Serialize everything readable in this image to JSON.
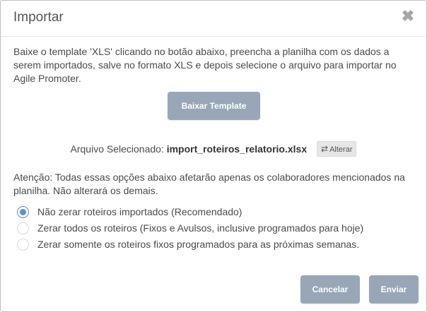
{
  "dialog": {
    "title": "Importar",
    "close_icon": "close-icon"
  },
  "description": "Baixe o template 'XLS' clicando no botão abaixo, preencha a planilha com os dados a serem importados, salve no formato XLS e depois selecione o arquivo para importar no Agile Promoter.",
  "download_button": "Baixar Template",
  "file": {
    "label": "Arquivo Selecionado:",
    "name": "import_roteiros_relatorio.xlsx",
    "change_icon": "swap-icon",
    "change_label": "Alterar"
  },
  "warning": "Atenção: Todas essas opções abaixo afetarão apenas os colaboradores mencionados na planilha. Não alterará os demais.",
  "options": [
    {
      "label": "Não zerar roteiros importados (Recomendado)",
      "checked": true
    },
    {
      "label": "Zerar todos os roteiros (Fixos e Avulsos, inclusive programados para hoje)",
      "checked": false
    },
    {
      "label": "Zerar somente os roteiros fixos programados para as próximas semanas.",
      "checked": false
    }
  ],
  "footer": {
    "cancel_label": "Cancelar",
    "send_label": "Enviar"
  },
  "colors": {
    "button": "#98a6b8",
    "radio_selected": "#5a8fd6"
  }
}
